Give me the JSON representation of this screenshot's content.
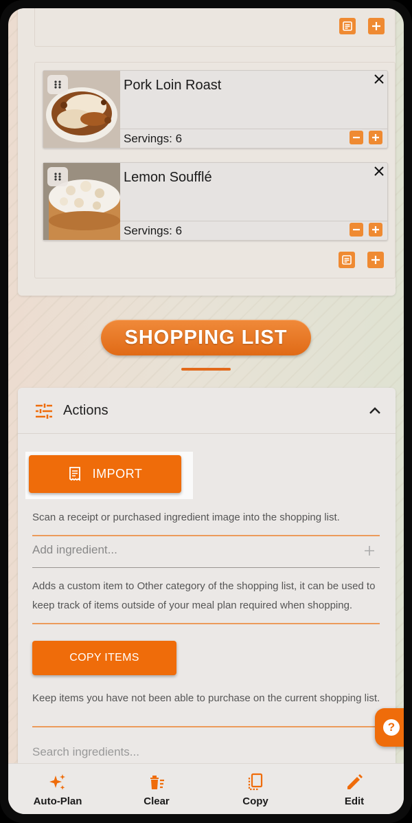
{
  "colors": {
    "accent": "#ef6c0a",
    "accent_light": "#ef8a32",
    "heading_gradient_top": "#f08a3a"
  },
  "meal_plan": {
    "recipes": [
      {
        "title": "Pork Loin Roast",
        "servings": "Servings: 6"
      },
      {
        "title": "Lemon Soufflé",
        "servings": "Servings: 6"
      }
    ]
  },
  "shopping_list": {
    "heading": "SHOPPING LIST",
    "actions": {
      "label": "Actions",
      "import_label": "IMPORT",
      "import_help": "Scan a receipt or purchased ingredient image into the shopping list.",
      "add_placeholder": "Add ingredient...",
      "add_help": "Adds a custom item to Other category of the shopping list, it can be used to keep track of items outside of your meal plan required when shopping.",
      "copy_label": "COPY ITEMS",
      "copy_help": "Keep items you have not been able to purchase on the current shopping list.",
      "search_placeholder": "Search ingredients..."
    }
  },
  "help_fab": {
    "glyph": "?"
  },
  "bottom_nav": [
    {
      "label": "Auto-Plan",
      "icon": "sparkles-icon"
    },
    {
      "label": "Clear",
      "icon": "clear-list-icon"
    },
    {
      "label": "Copy",
      "icon": "copy-icon"
    },
    {
      "label": "Edit",
      "icon": "pencil-icon"
    }
  ]
}
